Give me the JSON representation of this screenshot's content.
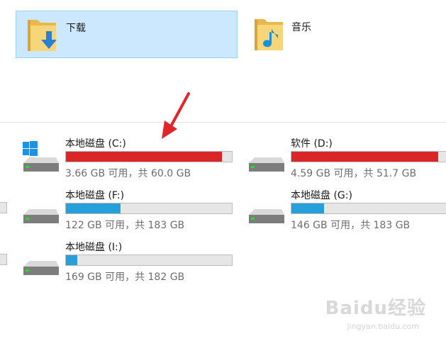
{
  "folders": [
    {
      "label": "下载",
      "icon": "downloads-folder-icon"
    },
    {
      "label": "音乐",
      "icon": "music-folder-icon"
    }
  ],
  "drives": [
    {
      "name": "本地磁盘 (C:)",
      "free": "3.66 GB 可用，共 60.0 GB",
      "used_fraction": 0.94,
      "bar_color": "#da2626",
      "icon": "windows-drive-icon"
    },
    {
      "name": "软件 (D:)",
      "free": "4.59 GB 可用，共 51.7 GB",
      "used_fraction": 0.91,
      "bar_color": "#da2626",
      "icon": "drive-icon"
    },
    {
      "name": "本地磁盘 (F:)",
      "free": "122 GB 可用，共 183 GB",
      "used_fraction": 0.33,
      "bar_color": "#26a0da",
      "icon": "drive-icon"
    },
    {
      "name": "本地磁盘 (G:)",
      "free": "146 GB 可用，共 183 GB",
      "used_fraction": 0.2,
      "bar_color": "#26a0da",
      "icon": "drive-icon"
    },
    {
      "name": "本地磁盘 (I:)",
      "free": "169 GB 可用，共 182 GB",
      "used_fraction": 0.07,
      "bar_color": "#26a0da",
      "icon": "drive-icon"
    }
  ],
  "annotation": {
    "icon": "red-arrow-icon",
    "color": "#e0262a"
  },
  "watermark": {
    "logo": "Baidu经验",
    "url": "jingyan.baidu.com"
  }
}
